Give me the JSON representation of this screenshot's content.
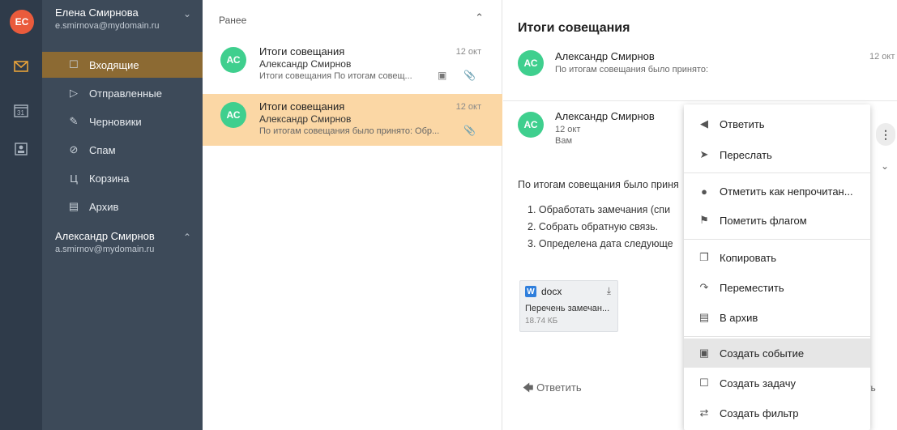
{
  "accounts": [
    {
      "initials": "ЕС",
      "name": "Елена Смирнова",
      "email": "e.smirnova@mydomain.ru"
    },
    {
      "name": "Александр Смирнов",
      "email": "a.smirnov@mydomain.ru"
    }
  ],
  "folders": [
    {
      "label": "Входящие",
      "icon": "inbox-icon"
    },
    {
      "label": "Отправленные",
      "icon": "send-icon"
    },
    {
      "label": "Черновики",
      "icon": "draft-icon"
    },
    {
      "label": "Спам",
      "icon": "spam-icon"
    },
    {
      "label": "Корзина",
      "icon": "trash-icon"
    },
    {
      "label": "Архив",
      "icon": "archive-icon"
    }
  ],
  "list": {
    "header": "Ранее",
    "items": [
      {
        "initials": "АС",
        "subject": "Итоги совещания",
        "from": "Александр Смирнов",
        "preview": "Итоги совещания По итогам совещ...",
        "date": "12 окт"
      },
      {
        "initials": "АС",
        "subject": "Итоги совещания",
        "from": "Александр Смирнов",
        "preview": "По итогам совещания было принято: Обр...",
        "date": "12 окт"
      }
    ]
  },
  "reader": {
    "title": "Итоги совещания",
    "msg1": {
      "initials": "АС",
      "from": "Александр Смирнов",
      "preview": "По итогам совещания было принято:",
      "date": "12 окт"
    },
    "msg2": {
      "initials": "АС",
      "from": "Александр Смирнов",
      "date": "12 окт",
      "to": "Вам"
    },
    "body": "По итогам совещания было приня",
    "items": [
      "1. Обработать замечания (спи",
      "2. Собрать обратную связь.",
      "3. Определена дата следующе"
    ],
    "attachment": {
      "ext": "docx",
      "name": "Перечень замечан...",
      "size": "18.74 КБ"
    },
    "reply": "Ответить",
    "trail": "ть"
  },
  "menu": [
    {
      "label": "Ответить",
      "icon": "reply-icon"
    },
    {
      "label": "Переслать",
      "icon": "forward-icon"
    },
    {
      "label": "Отметить как непрочитан...",
      "icon": "unread-dot-icon"
    },
    {
      "label": "Пометить флагом",
      "icon": "flag-icon"
    },
    {
      "label": "Копировать",
      "icon": "copy-icon"
    },
    {
      "label": "Переместить",
      "icon": "move-icon"
    },
    {
      "label": "В архив",
      "icon": "archive-icon"
    },
    {
      "label": "Создать событие",
      "icon": "calendar-event-icon"
    },
    {
      "label": "Создать задачу",
      "icon": "task-icon"
    },
    {
      "label": "Создать фильтр",
      "icon": "filter-icon"
    }
  ],
  "colors": {
    "rail": "#2f3b4a",
    "sidebar": "#3d4a59",
    "active_folder": "#8c6a33",
    "selected_item": "#fbd7a5",
    "avatar": "#3fcf8e",
    "user_avatar": "#ea5b3c"
  }
}
